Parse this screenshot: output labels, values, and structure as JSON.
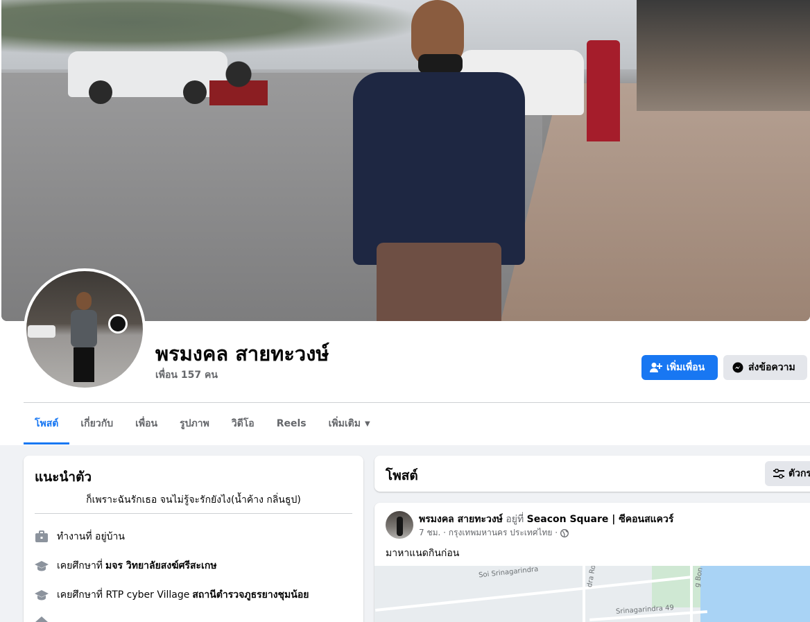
{
  "profile": {
    "name": "พรมงคล สายทะวงษ์",
    "friends": "เพื่อน 157 คน"
  },
  "actions": {
    "add_friend": "เพิ่มเพื่อน",
    "message": "ส่งข้อความ"
  },
  "tabs": [
    {
      "label": "โพสต์",
      "active": true
    },
    {
      "label": "เกี่ยวกับ"
    },
    {
      "label": "เพื่อน"
    },
    {
      "label": "รูปภาพ"
    },
    {
      "label": "วิดีโอ"
    },
    {
      "label": "Reels"
    },
    {
      "label": "เพิ่มเติม"
    }
  ],
  "intro": {
    "title": "แนะนำตัว",
    "bio": "ก็เพราะฉันรักเธอ จนไม่รู้จะรักยังไง(น้ำค้าง กลิ่นธูป)",
    "items": [
      {
        "prefix": "ทำงานที่ อยู่บ้าน",
        "bold": "",
        "icon": "briefcase-icon"
      },
      {
        "prefix": "เคยศึกษาที่",
        "bold": "มจร วิทยาลัยสงฆ์ศรีสะเกษ",
        "icon": "graduation-cap-icon"
      },
      {
        "prefix": "เคยศึกษาที่ RTP cyber Village",
        "bold": "สถานีตำรวจภูธรยางชุมน้อย",
        "icon": "graduation-cap-icon"
      }
    ]
  },
  "posts": {
    "title": "โพสต์",
    "filter_label": "ตัวกรอง"
  },
  "post": {
    "author": "พรมงคล สายทะวงษ์",
    "at": "อยู่ที่",
    "place": "Seacon Square | ซีคอนสแควร์",
    "meta": "7 ชม. · กรุงเทพมหานคร ประเทศไทย ·",
    "text": "มาหาแนดกินก่อน",
    "map_labels": [
      "Soi Srinagarindra",
      "dra Road",
      "Srinagarindra 49",
      "g Bon"
    ]
  },
  "colors": {
    "accent": "#1877f2",
    "background": "#f0f2f5",
    "secondary_text": "#65676b"
  }
}
